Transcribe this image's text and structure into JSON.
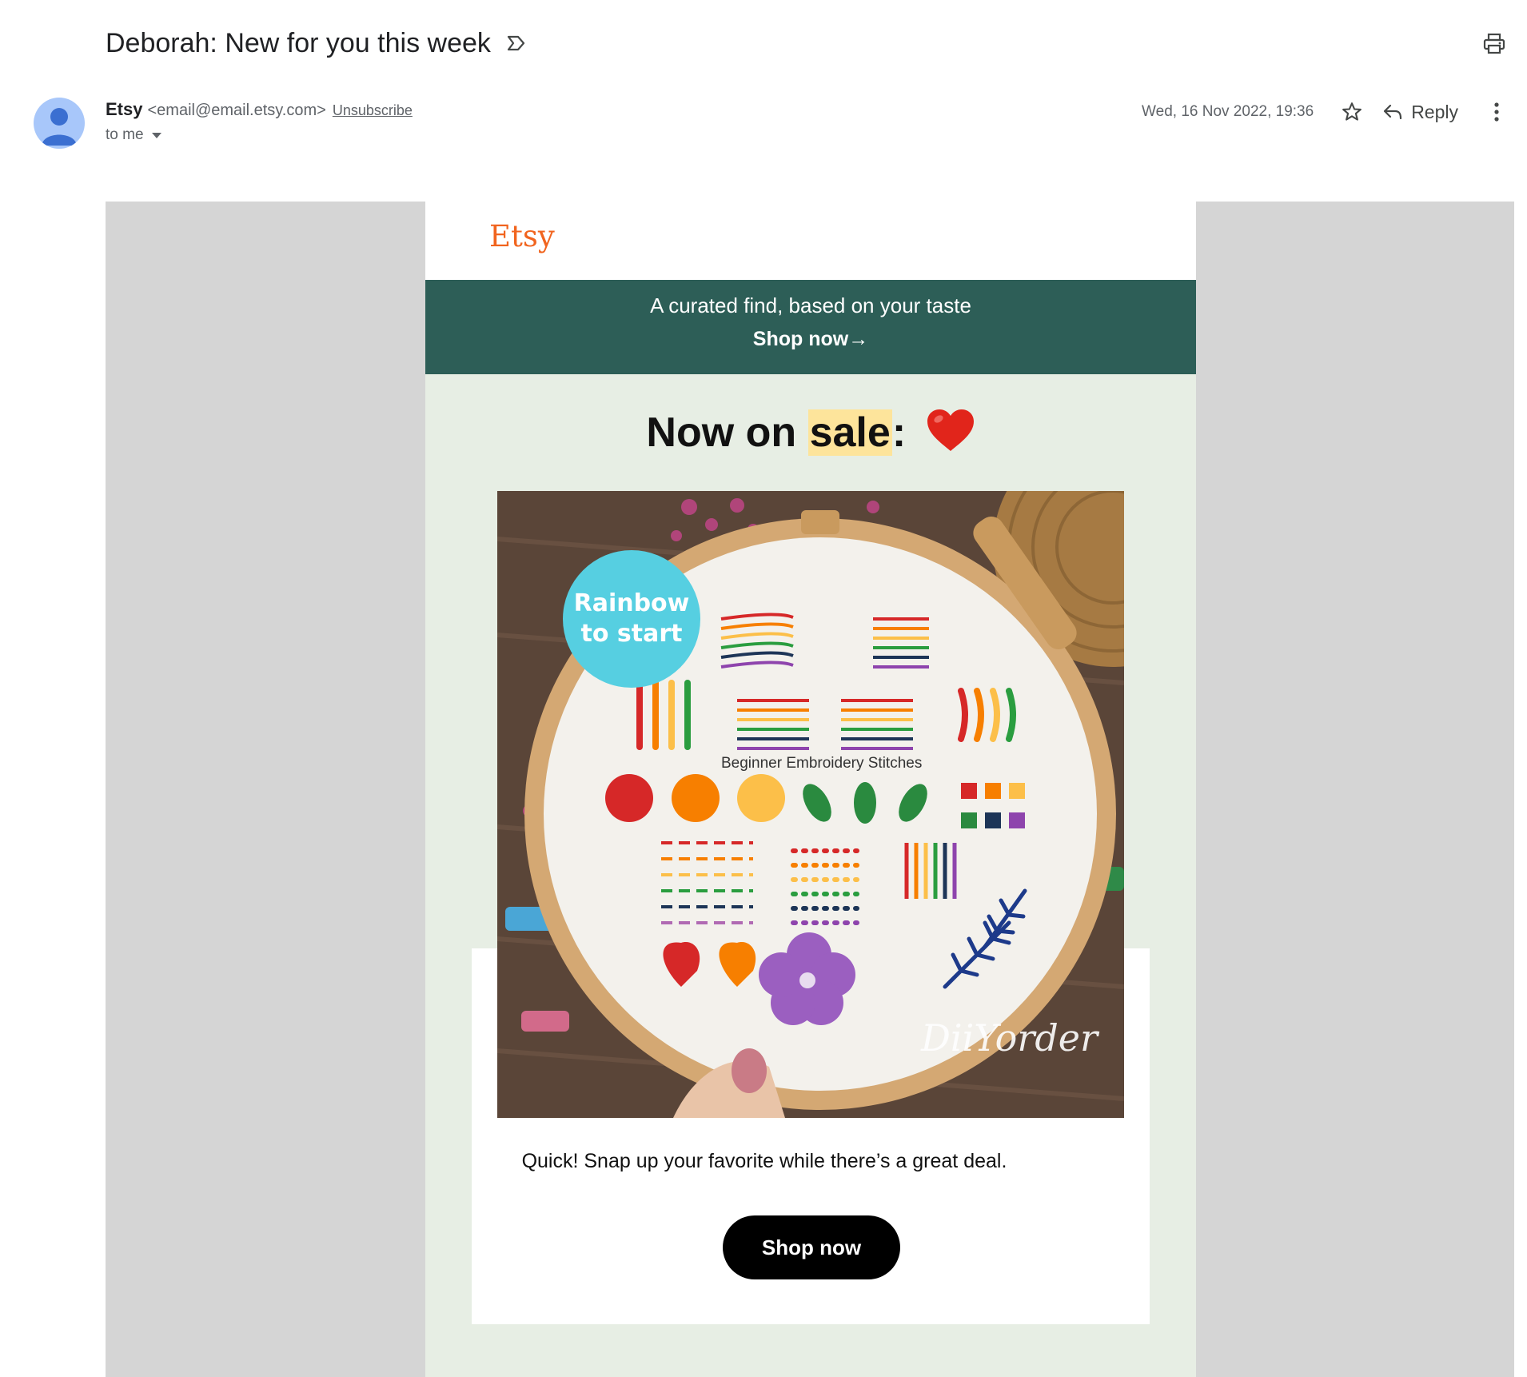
{
  "email": {
    "subject": "Deborah: New for you this week",
    "sender_name": "Etsy",
    "sender_email": "<email@email.etsy.com>",
    "unsubscribe_label": "Unsubscribe",
    "recipient_label": "to me",
    "date": "Wed, 16 Nov 2022, 19:36",
    "reply_label": "Reply",
    "icons": [
      "label-icon",
      "print-icon",
      "avatar",
      "star-icon",
      "reply-icon",
      "more-vertical-icon",
      "caret-down-icon"
    ]
  },
  "message": {
    "logo": "Etsy",
    "banner_text": "A curated find, based on your taste",
    "banner_cta": "Shop now→",
    "headline_prefix": "Now on ",
    "headline_highlight": "sale",
    "headline_suffix": ":",
    "heart_icon": "heart-icon",
    "product_image": {
      "badge_line1": "Rainbow",
      "badge_line2": "to start",
      "hoop_title": "Beginner Embroidery Stitches",
      "watermark": "DiiYorder"
    },
    "body_text": "Quick! Snap up your favorite while there’s a great deal.",
    "shop_button_label": "Shop now"
  },
  "colors": {
    "etsy_orange": "#f1641e",
    "banner_green": "#2d5e57",
    "content_bg": "#e7eee4",
    "frame_gray": "#d5d5d5",
    "highlight": "#fde49b",
    "badge_blue": "#56cfe1"
  }
}
